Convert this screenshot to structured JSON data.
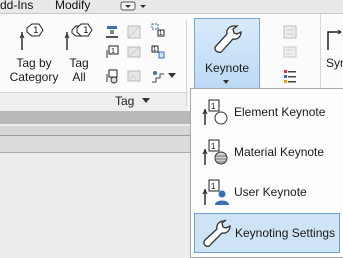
{
  "menubar": {
    "tabs": [
      "dd-Ins",
      "Modify"
    ]
  },
  "ribbon": {
    "tag_by_category": {
      "line1": "Tag by",
      "line2": "Category"
    },
    "tag_all": {
      "line1": "Tag",
      "line2": "All"
    },
    "panel_title": "Tag",
    "keynote": "Keynote",
    "right_cut_label": "Syn"
  },
  "keynote_menu": {
    "items": [
      {
        "label": "Element Keynote",
        "icon": "element-keynote-icon"
      },
      {
        "label": "Material Keynote",
        "icon": "material-keynote-icon"
      },
      {
        "label": "User Keynote",
        "icon": "user-keynote-icon"
      },
      {
        "label": "Keynoting Settings",
        "icon": "wrench-icon",
        "selected": true
      }
    ]
  },
  "colors": {
    "accent": "#7aa7d6",
    "highlight": "#cfe3f7"
  }
}
